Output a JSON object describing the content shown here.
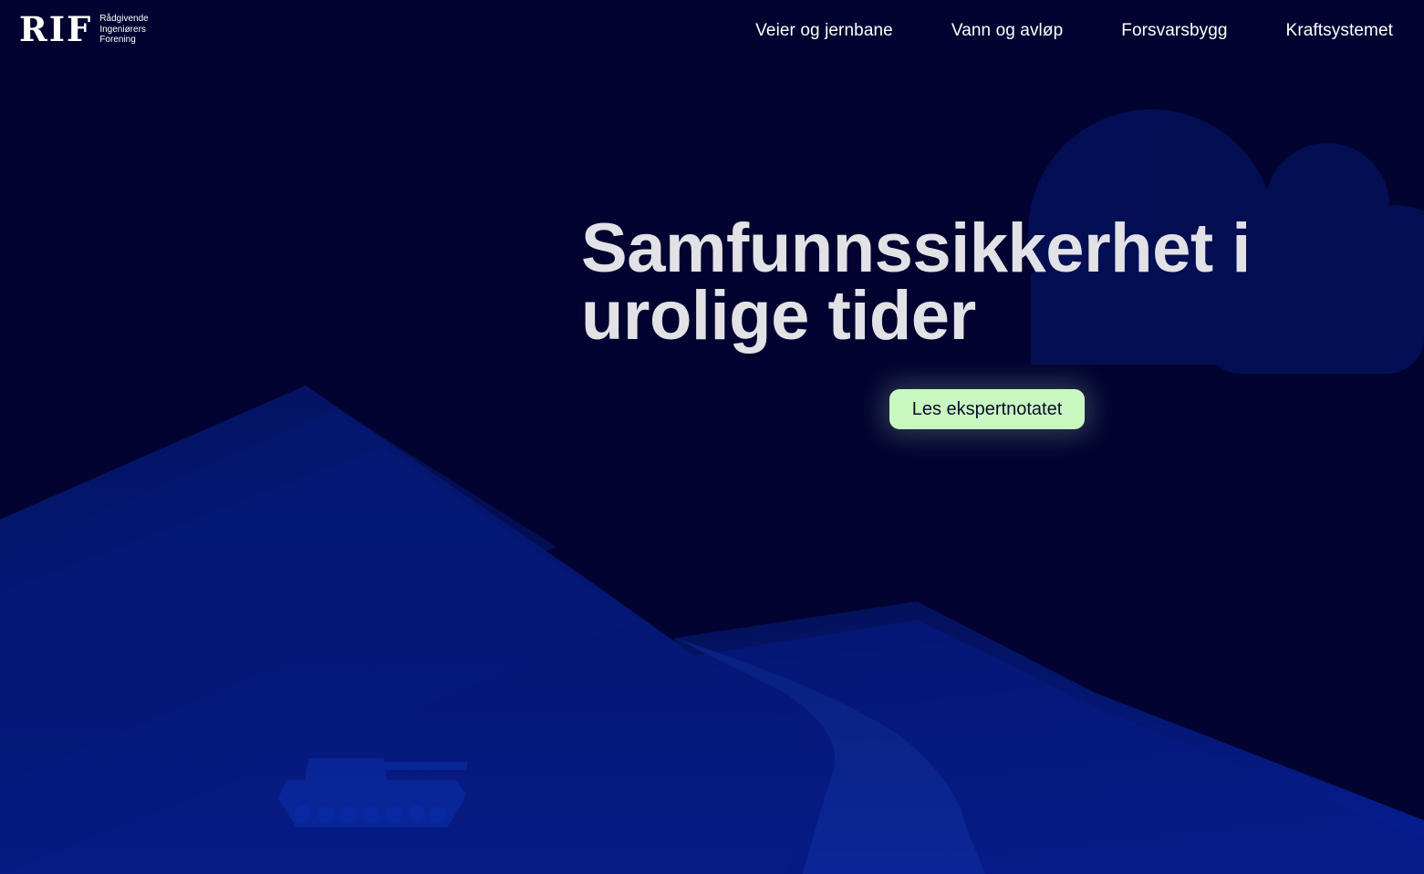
{
  "logo": {
    "mark": "RIF",
    "line1": "Rådgivende",
    "line2": "Ingeniørers",
    "line3": "Forening"
  },
  "nav": {
    "items": [
      {
        "label": "Veier og jernbane"
      },
      {
        "label": "Vann og avløp"
      },
      {
        "label": "Forsvarsbygg"
      },
      {
        "label": "Kraftsystemet"
      }
    ]
  },
  "hero": {
    "title_line1": "Samfunnssikkerhet i",
    "title_line2": "urolige tider",
    "cta_label": "Les ekspertnotatet"
  },
  "colors": {
    "background": "#020330",
    "headline": "#e2e2e6",
    "cta_background": "#c9f7c0",
    "mountain": "#0a1a6e",
    "road": "#0b2394"
  }
}
